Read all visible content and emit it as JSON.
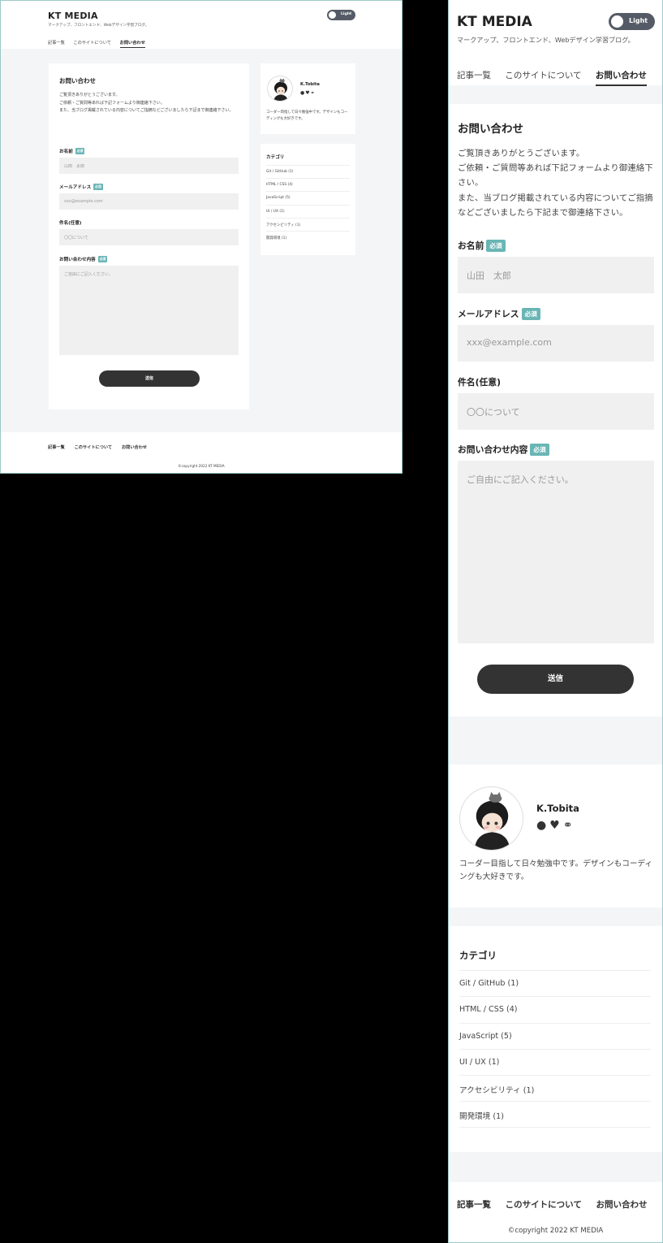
{
  "site": {
    "logo": "KT MEDIA",
    "tagline": "マークアップ、フロントエンド、Webデザイン学習ブログ。",
    "theme_toggle_label": "Light"
  },
  "nav": {
    "items": [
      {
        "label": "記事一覧",
        "active": false
      },
      {
        "label": "このサイトについて",
        "active": false
      },
      {
        "label": "お問い合わせ",
        "active": true
      }
    ]
  },
  "contact": {
    "title": "お問い合わせ",
    "intro": [
      "ご覧頂きありがとうございます。",
      "ご依頼・ご質問等あれば下記フォームより御連絡下さい。",
      "また、当ブログ掲載されている内容についてご指摘などございましたら下記まで御連絡下さい。"
    ],
    "required_badge": "必須",
    "fields": {
      "name": {
        "label": "お名前",
        "placeholder": "山田　太郎",
        "required": true
      },
      "email": {
        "label": "メールアドレス",
        "placeholder": "xxx@example.com",
        "required": true
      },
      "subject": {
        "label": "件名(任意)",
        "placeholder": "〇〇について",
        "required": false
      },
      "message": {
        "label": "お問い合わせ内容",
        "placeholder": "ご自由にご記入ください。",
        "required": true
      }
    },
    "submit_label": "送信"
  },
  "profile": {
    "name": "K.Tobita",
    "icons": [
      "github-icon",
      "twitter-icon",
      "link-icon"
    ],
    "description": "コーダー目指して日々勉強中です。デザインもコーディングも大好きです。"
  },
  "categories": {
    "title": "カテゴリ",
    "items": [
      "Git / GitHub (1)",
      "HTML / CSS (4)",
      "JavaScript (5)",
      "UI / UX (1)",
      "アクセシビリティ (1)",
      "開発環境 (1)"
    ]
  },
  "footer": {
    "nav": [
      "記事一覧",
      "このサイトについて",
      "お問い合わせ"
    ],
    "copyright": "©copyright 2022 KT MEDIA"
  },
  "colors": {
    "accent": "#6ab5b5",
    "button": "#333333",
    "toggle": "#555b66",
    "page_bg": "#f4f5f7"
  }
}
